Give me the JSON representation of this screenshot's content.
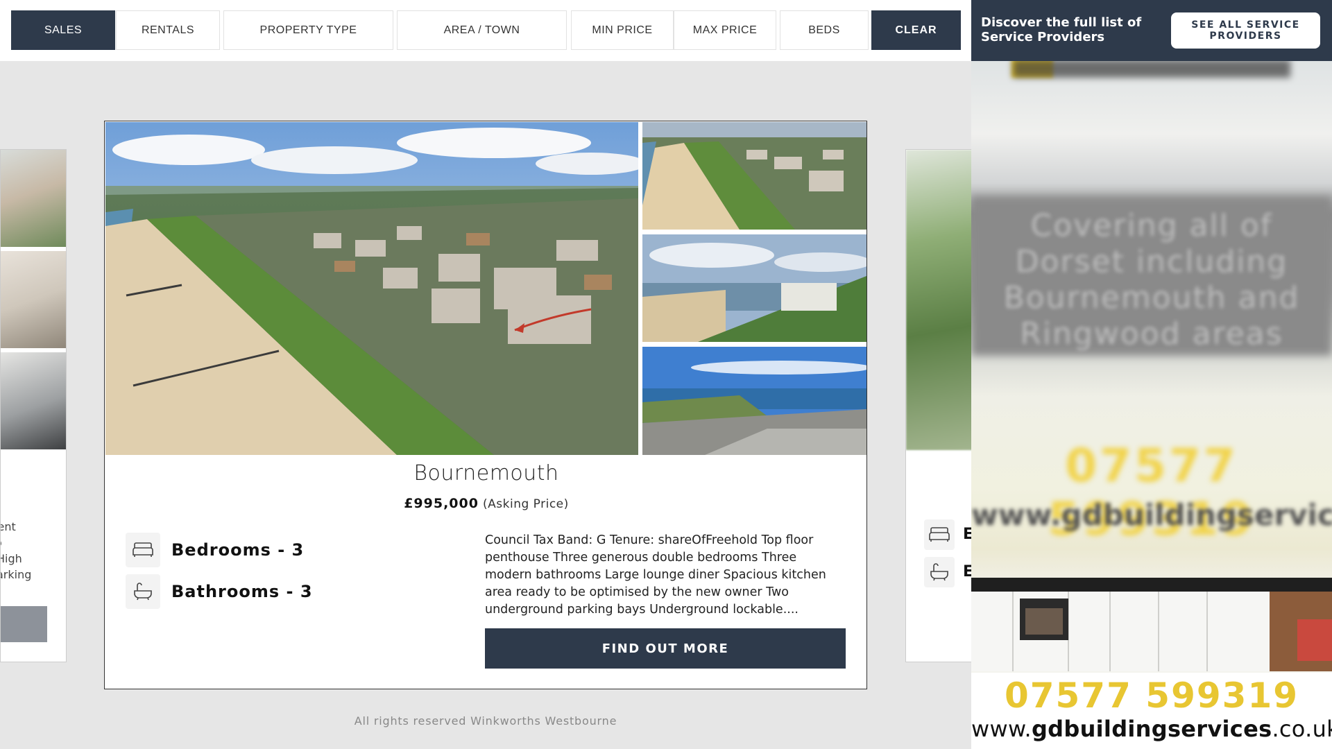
{
  "filters": {
    "sales": "SALES",
    "rentals": "RENTALS",
    "property_type": "PROPERTY TYPE",
    "area_town": "AREA / TOWN",
    "min_price": "MIN PRICE",
    "max_price": "MAX PRICE",
    "beds": "BEDS",
    "clear": "CLEAR"
  },
  "ghost_left": {
    "lines": [
      "opment",
      "o",
      "High",
      "arking"
    ]
  },
  "ghost_right": {
    "letters": [
      "E",
      "E"
    ]
  },
  "listing": {
    "town": "Bournemouth",
    "price": "£995,000",
    "price_qualifier": "(Asking Price)",
    "bedrooms": "Bedrooms - 3",
    "bathrooms": "Bathrooms - 3",
    "description": "Council Tax Band: G Tenure: shareOfFreehold Top floor penthouse Three generous double bedrooms Three modern bathrooms Large lounge diner Spacious kitchen area ready to be optimised by the new owner Two underground parking bays Underground lockable....",
    "cta": "FIND OUT MORE"
  },
  "footer": "All rights reserved Winkworths Westbourne",
  "ad": {
    "discover": "Discover the full list of Service Providers",
    "see_all": "SEE ALL SERVICE PROVIDERS",
    "blur_text": "Covering all of Dorset including Bournemouth and Ringwood areas",
    "blur_phone": "07577 599319",
    "blur_web": "www.gdbuildingservices.co.uk",
    "phone": "07577 599319",
    "web_prefix": "www.",
    "web_domain": "gdbuildingservices",
    "web_suffix": ".co.uk"
  },
  "icons": {
    "bed": "bed-icon",
    "bath": "bath-icon"
  },
  "colors": {
    "navy": "#2e3a4b",
    "ad_yellow": "#e8c632",
    "background": "#e6e6e6"
  }
}
